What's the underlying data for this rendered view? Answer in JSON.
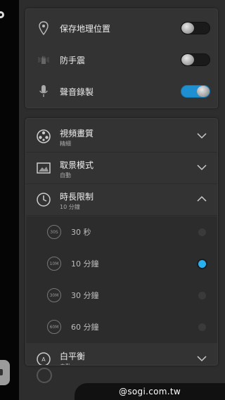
{
  "toggles": {
    "location": {
      "label": "保存地理位置",
      "state": "off"
    },
    "stabilizer": {
      "label": "防手震",
      "state": "off"
    },
    "audio": {
      "label": "聲音錄製",
      "state": "on"
    }
  },
  "menu": {
    "video_quality": {
      "title": "視頻畫質",
      "value": "精細",
      "expanded": false
    },
    "scene_mode": {
      "title": "取景模式",
      "value": "自動",
      "expanded": false
    },
    "duration_limit": {
      "title": "時長限制",
      "value": "10 分鐘",
      "expanded": true
    },
    "white_balance": {
      "title": "白平衡",
      "value": "自動",
      "expanded": false
    }
  },
  "duration_options": [
    {
      "badge": "30S",
      "label": "30 秒",
      "selected": false
    },
    {
      "badge": "10M",
      "label": "10 分鐘",
      "selected": true
    },
    {
      "badge": "30M",
      "label": "30 分鐘",
      "selected": false
    },
    {
      "badge": "60M",
      "label": "60 分鐘",
      "selected": false
    }
  ],
  "watermark": "@sogi.com.tw",
  "colors": {
    "accent": "#29b0f0",
    "toggle_on": "#1e90d2",
    "panel": "#333333"
  }
}
